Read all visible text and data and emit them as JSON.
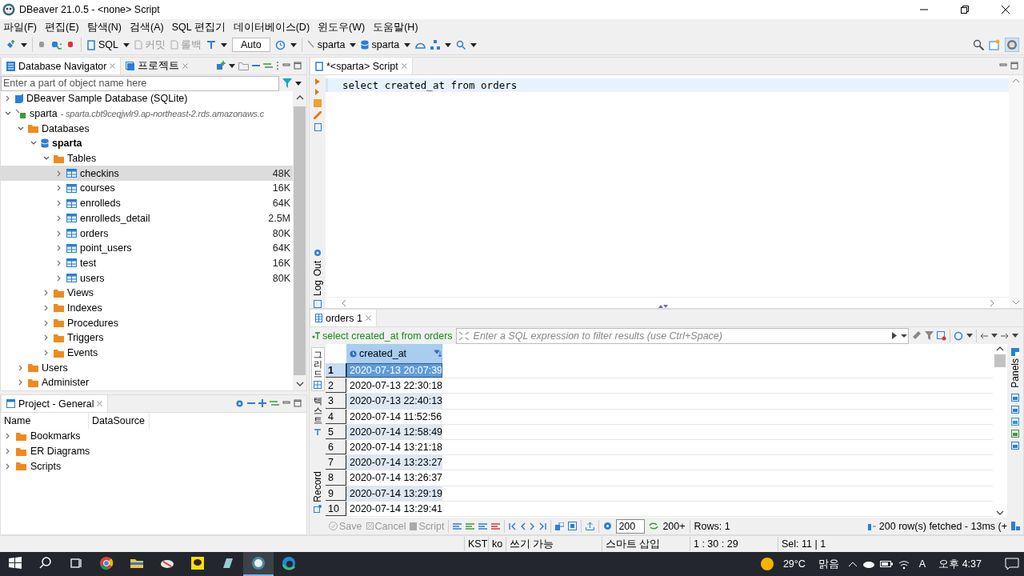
{
  "window": {
    "title": "DBeaver 21.0.5 - <none> Script"
  },
  "menu": [
    "파일(F)",
    "편집(E)",
    "탐색(N)",
    "검색(A)",
    "SQL 편집기",
    "데이터베이스(D)",
    "윈도우(W)",
    "도움말(H)"
  ],
  "toolbar": {
    "sql": "SQL",
    "commit": {
      "label": "커밋",
      "disabled": true
    },
    "rollback": {
      "label": "롤백",
      "disabled": true
    },
    "mode": "Auto",
    "connection": "sparta",
    "schema": "sparta"
  },
  "navigator": {
    "tabs": [
      {
        "label": "Database Navigator",
        "selected": true
      },
      {
        "label": "프로젝트",
        "selected": false
      }
    ],
    "filter_placeholder": "Enter a part of object name here",
    "tree": [
      {
        "label": "DBeaver Sample Database (SQLite)",
        "kind": "sample",
        "expanded": false,
        "selected": false
      },
      {
        "label": "sparta",
        "kind": "connection",
        "detail": "- sparta.cbt9ceqjwlr9.ap-northeast-2.rds.amazonaws.c",
        "expanded": true,
        "selected": false,
        "children": [
          {
            "label": "Databases",
            "kind": "folder",
            "expanded": true,
            "selected": false,
            "children": [
              {
                "label": "sparta",
                "kind": "database",
                "bold": true,
                "expanded": true,
                "selected": false,
                "children": [
                  {
                    "label": "Tables",
                    "kind": "folder",
                    "expanded": true,
                    "selected": false,
                    "children": [
                      {
                        "label": "checkins",
                        "kind": "table",
                        "size": "48K",
                        "expanded": false,
                        "selected": true
                      },
                      {
                        "label": "courses",
                        "kind": "table",
                        "size": "16K",
                        "expanded": false,
                        "selected": false
                      },
                      {
                        "label": "enrolleds",
                        "kind": "table",
                        "size": "64K",
                        "expanded": false,
                        "selected": false
                      },
                      {
                        "label": "enrolleds_detail",
                        "kind": "table",
                        "size": "2.5M",
                        "expanded": false,
                        "selected": false
                      },
                      {
                        "label": "orders",
                        "kind": "table",
                        "size": "80K",
                        "expanded": false,
                        "selected": false
                      },
                      {
                        "label": "point_users",
                        "kind": "table",
                        "size": "64K",
                        "expanded": false,
                        "selected": false
                      },
                      {
                        "label": "test",
                        "kind": "table",
                        "size": "16K",
                        "expanded": false,
                        "selected": false
                      },
                      {
                        "label": "users",
                        "kind": "table",
                        "size": "80K",
                        "expanded": false,
                        "selected": false
                      }
                    ]
                  },
                  {
                    "label": "Views",
                    "kind": "folder",
                    "expanded": false,
                    "selected": false
                  },
                  {
                    "label": "Indexes",
                    "kind": "folder",
                    "expanded": false,
                    "selected": false
                  },
                  {
                    "label": "Procedures",
                    "kind": "folder",
                    "expanded": false,
                    "selected": false
                  },
                  {
                    "label": "Triggers",
                    "kind": "folder",
                    "expanded": false,
                    "selected": false
                  },
                  {
                    "label": "Events",
                    "kind": "folder",
                    "expanded": false,
                    "selected": false
                  }
                ]
              }
            ]
          },
          {
            "label": "Users",
            "kind": "folder",
            "expanded": false,
            "selected": false
          },
          {
            "label": "Administer",
            "kind": "folder",
            "expanded": false,
            "selected": false
          }
        ]
      }
    ]
  },
  "project": {
    "title": "Project - General",
    "columns": [
      "Name",
      "DataSource"
    ],
    "items": [
      {
        "label": "Bookmarks",
        "expanded": false
      },
      {
        "label": "ER Diagrams",
        "expanded": false
      },
      {
        "label": "Scripts",
        "expanded": false
      }
    ]
  },
  "editor": {
    "tab": "*<sparta> Script",
    "code": "select created_at from orders",
    "side_tabs": [
      "Out",
      "Log"
    ]
  },
  "results": {
    "tab": "orders 1",
    "query": "select created_at from orders",
    "filter_placeholder": "Enter a SQL expression to filter results (use Ctrl+Space)",
    "view_tabs": [
      {
        "label": "그리드",
        "kind": "korean",
        "selected": true
      },
      {
        "label": "텍스트",
        "kind": "korean",
        "selected": false
      },
      {
        "label": "Record",
        "kind": "latin",
        "selected": false
      }
    ],
    "column": "created_at",
    "panels": "Panels",
    "rows": [
      {
        "num": "1",
        "value": "2020-07-13 20:07:39",
        "selected": true
      },
      {
        "num": "2",
        "value": "2020-07-13 22:30:18",
        "selected": false
      },
      {
        "num": "3",
        "value": "2020-07-13 22:40:13",
        "selected": false
      },
      {
        "num": "4",
        "value": "2020-07-14 11:52:56",
        "selected": false
      },
      {
        "num": "5",
        "value": "2020-07-14 12:58:49",
        "selected": false
      },
      {
        "num": "6",
        "value": "2020-07-14 13:21:18",
        "selected": false
      },
      {
        "num": "7",
        "value": "2020-07-14 13:23:27",
        "selected": false
      },
      {
        "num": "8",
        "value": "2020-07-14 13:26:37",
        "selected": false
      },
      {
        "num": "9",
        "value": "2020-07-14 13:29:19",
        "selected": false
      },
      {
        "num": "10",
        "value": "2020-07-14 13:29:41",
        "selected": false
      }
    ],
    "footer": {
      "save": "Save",
      "cancel": "Cancel",
      "script": "Script",
      "fetch_size": "200",
      "fetch_more": "200+",
      "rows": "Rows: 1",
      "fetched": "200 row(s) fetched - 13ms (+"
    }
  },
  "status_bar": [
    "KST",
    "ko",
    "쓰기 가능",
    "스마트 삽입",
    "1 : 30 : 29",
    "Sel: 11 | 1"
  ],
  "taskbar": {
    "weather": "29°C",
    "condition": "맑음",
    "ime": "A",
    "time": "오후 4:37"
  }
}
